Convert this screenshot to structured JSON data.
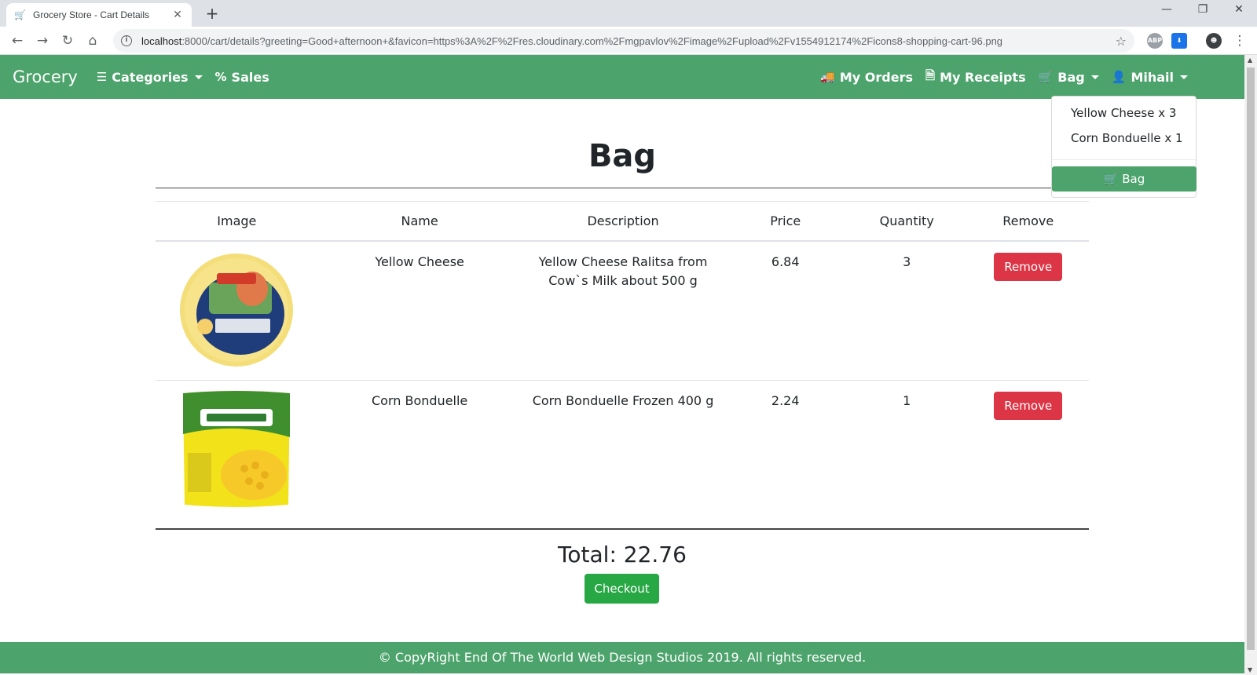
{
  "browser": {
    "tab_title": "Grocery Store - Cart Details",
    "tab_favicon": "shopping-cart-icon",
    "url_host": "localhost",
    "url_rest": ":8000/cart/details?greeting=Good+afternoon+&favicon=https%3A%2F%2Fres.cloudinary.com%2Fmgpavlov%2Fimage%2Fupload%2Fv1554912174%2Ficons8-shopping-cart-96.png",
    "ext_abp": "ABP"
  },
  "navbar": {
    "brand": "Grocery",
    "categories": "Categories",
    "sales": "Sales",
    "my_orders": "My Orders",
    "my_receipts": "My Receipts",
    "bag": "Bag",
    "user": "Mihail"
  },
  "dropdown": {
    "items": [
      "Yellow Cheese x 3",
      "Corn Bonduelle x 1"
    ],
    "bag_button": "Bag"
  },
  "page": {
    "title": "Bag",
    "columns": [
      "Image",
      "Name",
      "Description",
      "Price",
      "Quantity",
      "Remove"
    ],
    "rows": [
      {
        "name": "Yellow Cheese",
        "description": "Yellow Cheese Ralitsa from Cow`s Milk about 500 g",
        "price": "6.84",
        "quantity": "3",
        "remove": "Remove"
      },
      {
        "name": "Corn Bonduelle",
        "description": "Corn Bonduelle Frozen 400 g",
        "price": "2.24",
        "quantity": "1",
        "remove": "Remove"
      }
    ],
    "total": "Total: 22.76",
    "checkout": "Checkout"
  },
  "footer": {
    "text": "© CopyRight End Of The World Web Design Studios 2019. All rights reserved."
  },
  "colors": {
    "brand_green": "#4ca36b",
    "danger": "#dc3545",
    "success": "#28a745"
  }
}
